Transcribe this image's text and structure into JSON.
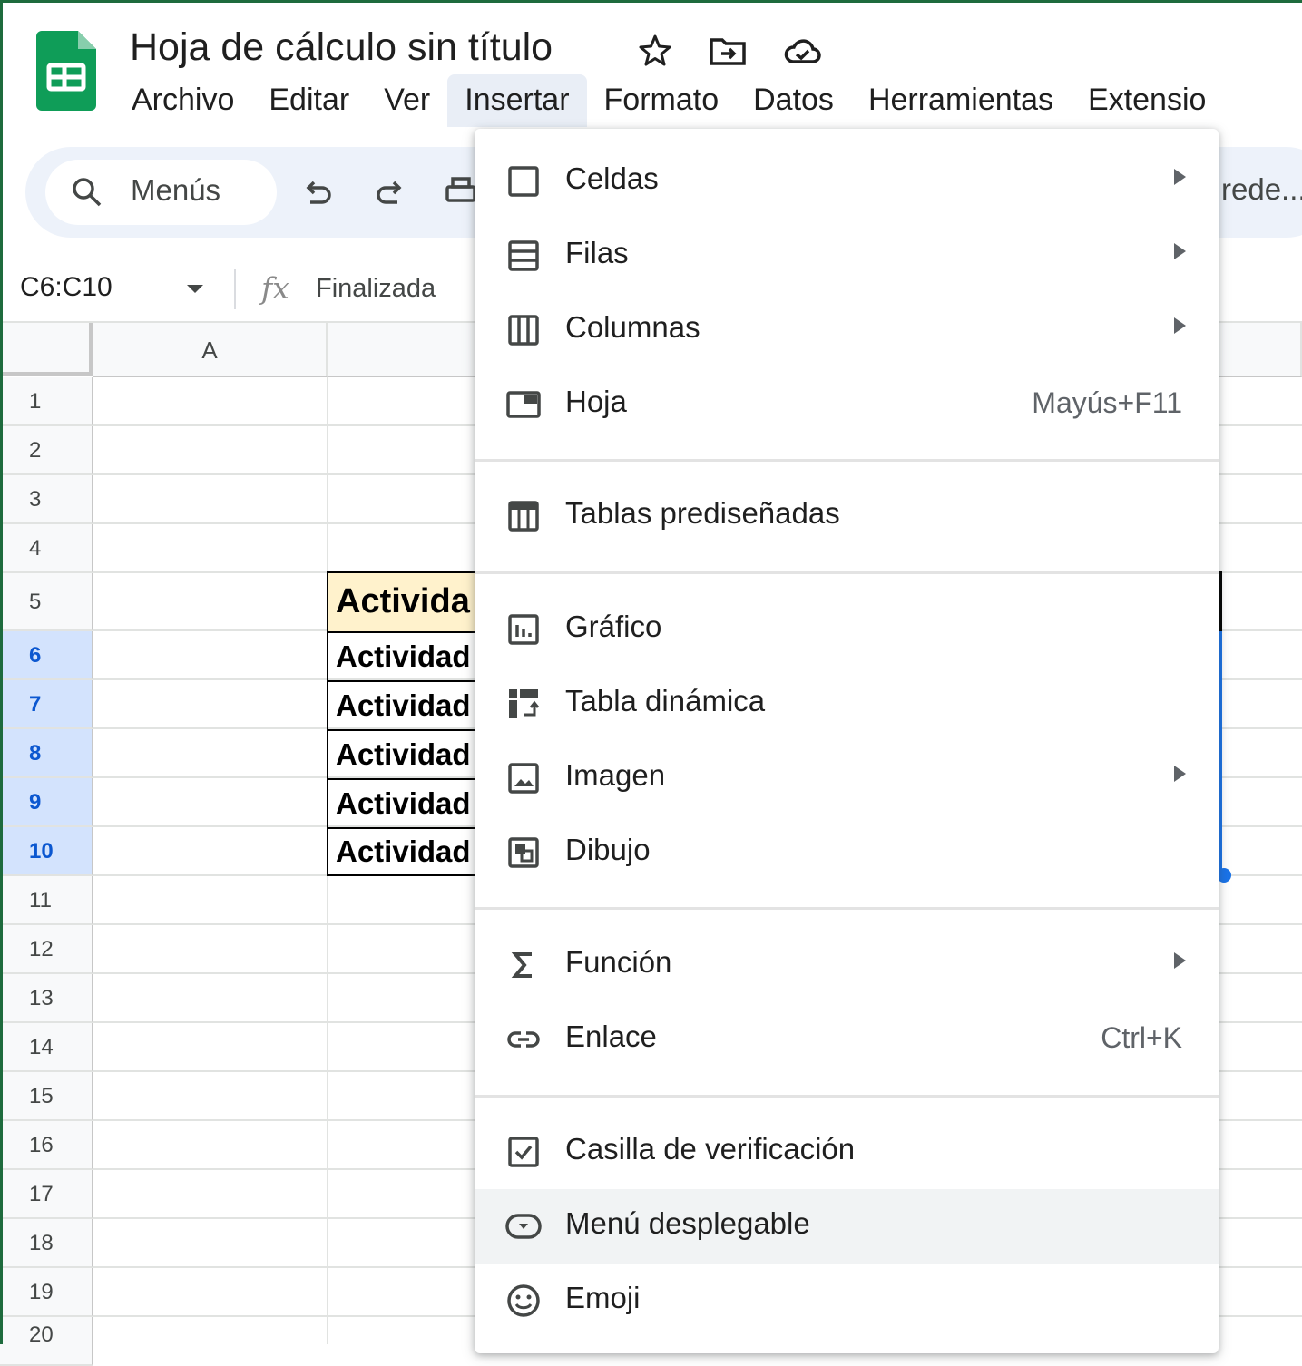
{
  "document": {
    "title": "Hoja de cálculo sin título",
    "title_icons": [
      "star-icon",
      "move-to-folder-icon",
      "cloud-saved-icon"
    ]
  },
  "menubar": {
    "items": [
      {
        "label": "Archivo"
      },
      {
        "label": "Editar"
      },
      {
        "label": "Ver"
      },
      {
        "label": "Insertar",
        "active": true
      },
      {
        "label": "Formato"
      },
      {
        "label": "Datos"
      },
      {
        "label": "Herramientas"
      },
      {
        "label": "Extensio"
      }
    ]
  },
  "toolbar": {
    "search_label": "Menús",
    "truncated_right": "rede..."
  },
  "formula_bar": {
    "name_box": "C6:C10",
    "fx_symbol": "fx",
    "value": "Finalizada"
  },
  "grid": {
    "columns": [
      {
        "label": "A"
      },
      {
        "label": ""
      }
    ],
    "rows": [
      "1",
      "2",
      "3",
      "4",
      "5",
      "6",
      "7",
      "8",
      "9",
      "10",
      "11",
      "12",
      "13",
      "14",
      "15",
      "16",
      "17",
      "18",
      "19",
      "20"
    ],
    "selected_rows": [
      "6",
      "7",
      "8",
      "9",
      "10"
    ],
    "cells": {
      "b5": "Activida",
      "b6": "Actividad",
      "b7": "Actividad",
      "b8": "Actividad",
      "b9": "Actividad",
      "b10": "Actividad"
    }
  },
  "insert_menu": {
    "items": [
      {
        "label": "Celdas",
        "icon": "square-icon",
        "submenu": true
      },
      {
        "label": "Filas",
        "icon": "rows-icon",
        "submenu": true
      },
      {
        "label": "Columnas",
        "icon": "columns-icon",
        "submenu": true
      },
      {
        "label": "Hoja",
        "icon": "sheet-icon",
        "shortcut": "Mayús+F11"
      },
      {
        "label": "Tablas prediseñadas",
        "icon": "table-icon"
      },
      {
        "label": "Gráfico",
        "icon": "chart-icon"
      },
      {
        "label": "Tabla dinámica",
        "icon": "pivot-table-icon"
      },
      {
        "label": "Imagen",
        "icon": "image-icon",
        "submenu": true
      },
      {
        "label": "Dibujo",
        "icon": "drawing-icon"
      },
      {
        "label": "Función",
        "icon": "sigma-icon",
        "submenu": true
      },
      {
        "label": "Enlace",
        "icon": "link-icon",
        "shortcut": "Ctrl+K"
      },
      {
        "label": "Casilla de verificación",
        "icon": "checkbox-icon"
      },
      {
        "label": "Menú desplegable",
        "icon": "dropdown-chip-icon",
        "hovered": true
      },
      {
        "label": "Emoji",
        "icon": "emoji-icon"
      }
    ]
  },
  "colors": {
    "sheets_green": "#0f9d58",
    "frame_green": "#1e6b3d",
    "selection_blue": "#1a73e8",
    "selected_header_bg": "#d3e3fd",
    "header_cell_bg": "#fff2cc",
    "menu_active_bg": "#e9eef6",
    "toolbar_bg": "#edf2fa"
  }
}
